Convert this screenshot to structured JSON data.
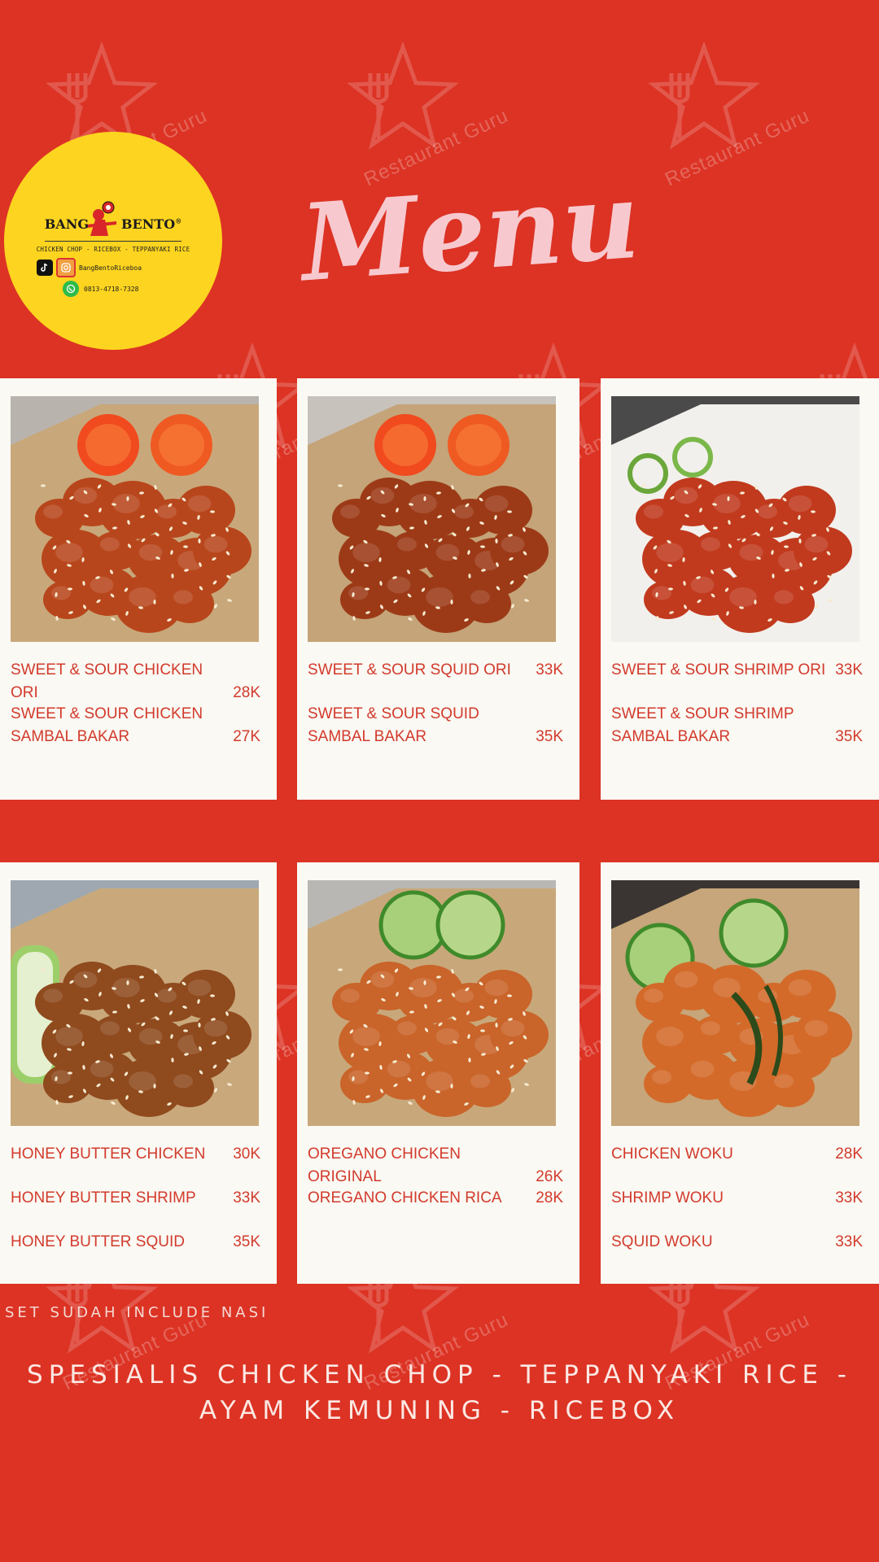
{
  "title": "Menu",
  "logo": {
    "brand_left": "BANG",
    "brand_right": "BENTO",
    "tagline": "CHICKEN CHOP - RICEBOX - TEPPANYAKI RICE",
    "social_handle": "BangBentoRiceboa",
    "phone": "0813-4718-7328"
  },
  "watermark": "Restaurant Guru",
  "cards": [
    {
      "items": [
        {
          "name_lines": [
            "SWEET & SOUR CHICKEN ORI"
          ],
          "price": "28K"
        },
        {
          "name_lines": [
            "SWEET & SOUR CHICKEN",
            "SAMBAL BAKAR"
          ],
          "price": "27K"
        }
      ]
    },
    {
      "items": [
        {
          "name_lines": [
            "SWEET & SOUR SQUID ORI"
          ],
          "price": "33K"
        },
        {
          "name_lines": [
            "SWEET & SOUR SQUID",
            "SAMBAL BAKAR"
          ],
          "price": "35K"
        }
      ]
    },
    {
      "items": [
        {
          "name_lines": [
            "SWEET & SOUR SHRIMP ORI"
          ],
          "price": "33K"
        },
        {
          "name_lines": [
            "SWEET & SOUR SHRIMP",
            "SAMBAL BAKAR"
          ],
          "price": "35K"
        }
      ]
    },
    {
      "items": [
        {
          "name_lines": [
            "HONEY BUTTER CHICKEN"
          ],
          "price": "30K"
        },
        {
          "name_lines": [
            "HONEY  BUTTER SHRIMP"
          ],
          "price": "33K"
        },
        {
          "name_lines": [
            "HONEY BUTTER SQUID"
          ],
          "price": "35K"
        }
      ]
    },
    {
      "items": [
        {
          "name_lines": [
            "OREGANO CHICKEN ORIGINAL"
          ],
          "price": "26K"
        },
        {
          "name_lines": [
            "OREGANO CHICKEN RICA"
          ],
          "price": "28K"
        }
      ]
    },
    {
      "items": [
        {
          "name_lines": [
            "CHICKEN WOKU"
          ],
          "price": "28K"
        },
        {
          "name_lines": [
            "SHRIMP WOKU"
          ],
          "price": "33K"
        },
        {
          "name_lines": [
            "SQUID WOKU"
          ],
          "price": "33K"
        }
      ]
    }
  ],
  "footer": {
    "note": "SET SUDAH INCLUDE NASI",
    "specialty_line1": "SPESIALIS CHICKEN CHOP - TEPPANYAKI RICE -",
    "specialty_line2": "AYAM KEMUNING - RICEBOX"
  },
  "colors": {
    "background": "#dc3324",
    "card": "#faf9f3",
    "item_text": "#d23a2c",
    "logo": "#fdd41f",
    "title": "#f7c9cf"
  }
}
